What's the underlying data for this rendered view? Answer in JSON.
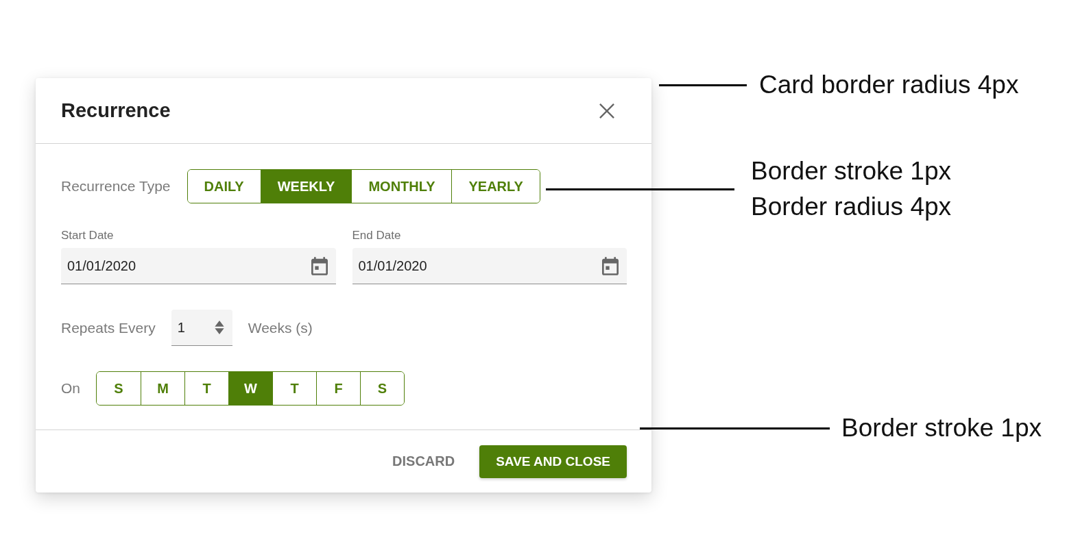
{
  "dialog": {
    "title": "Recurrence",
    "recurrence_type": {
      "label": "Recurrence Type",
      "options": [
        {
          "label": "DAILY",
          "selected": false
        },
        {
          "label": "WEEKLY",
          "selected": true
        },
        {
          "label": "MONTHLY",
          "selected": false
        },
        {
          "label": "YEARLY",
          "selected": false
        }
      ]
    },
    "start_date": {
      "label": "Start Date",
      "value": "01/01/2020"
    },
    "end_date": {
      "label": "End Date",
      "value": "01/01/2020"
    },
    "repeats": {
      "label": "Repeats Every",
      "value": "1",
      "unit": "Weeks (s)"
    },
    "days": {
      "label": "On",
      "options": [
        {
          "label": "S",
          "selected": false
        },
        {
          "label": "M",
          "selected": false
        },
        {
          "label": "T",
          "selected": false
        },
        {
          "label": "W",
          "selected": true
        },
        {
          "label": "T",
          "selected": false
        },
        {
          "label": "F",
          "selected": false
        },
        {
          "label": "S",
          "selected": false
        }
      ]
    },
    "buttons": [
      {
        "label": "DISCARD",
        "kind": "text"
      },
      {
        "label": "SAVE AND CLOSE",
        "kind": "primary"
      }
    ]
  },
  "annotations": [
    {
      "lines": [
        "Card border radius 4px"
      ]
    },
    {
      "lines": [
        "Border stroke 1px",
        "Border radius 4px"
      ]
    },
    {
      "lines": [
        "Border stroke 1px"
      ]
    }
  ]
}
